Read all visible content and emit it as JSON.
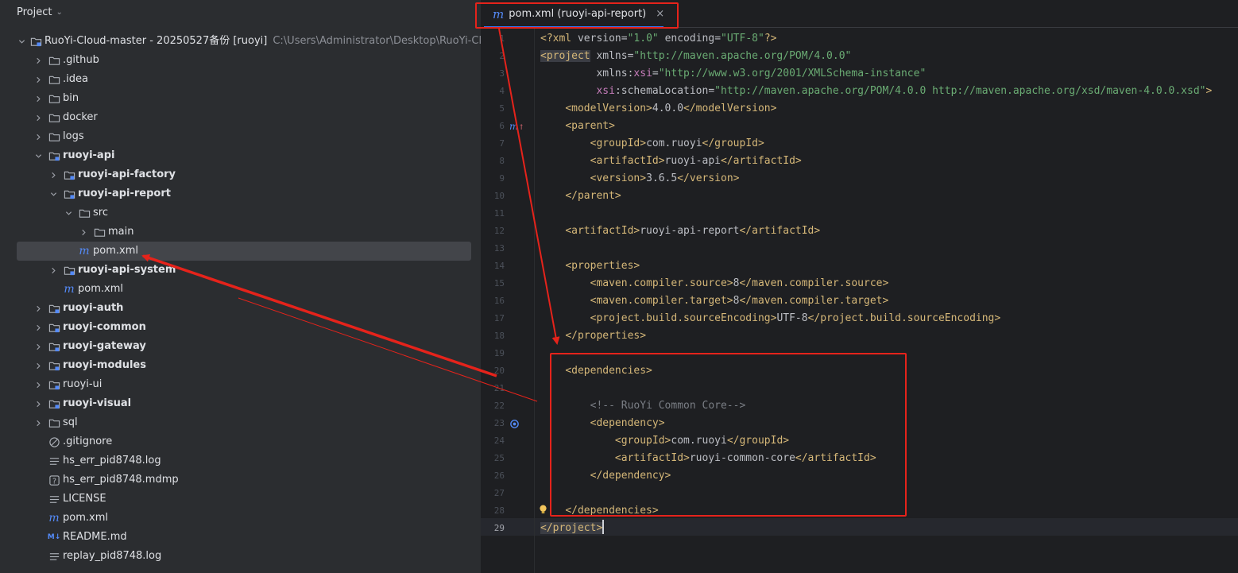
{
  "project_panel": {
    "title": "Project",
    "tree": [
      {
        "label": "RuoYi-Cloud-master - 20250527备份 [ruoyi]",
        "path": "C:\\Users\\Administrator\\Desktop\\RuoYi-Clo",
        "icon": "module-folder-icon",
        "depth": 0,
        "expanded": true,
        "bold": false
      },
      {
        "label": ".github",
        "icon": "folder-icon",
        "depth": 1,
        "expanded": false
      },
      {
        "label": ".idea",
        "icon": "folder-icon",
        "depth": 1,
        "expanded": false
      },
      {
        "label": "bin",
        "icon": "folder-icon",
        "depth": 1,
        "expanded": false
      },
      {
        "label": "docker",
        "icon": "folder-icon",
        "depth": 1,
        "expanded": false
      },
      {
        "label": "logs",
        "icon": "folder-icon",
        "depth": 1,
        "expanded": false
      },
      {
        "label": "ruoyi-api",
        "icon": "module-folder-icon",
        "depth": 1,
        "expanded": true,
        "bold": true
      },
      {
        "label": "ruoyi-api-factory",
        "icon": "module-folder-icon",
        "depth": 2,
        "expanded": false,
        "bold": true
      },
      {
        "label": "ruoyi-api-report",
        "icon": "module-folder-icon",
        "depth": 2,
        "expanded": true,
        "bold": true
      },
      {
        "label": "src",
        "icon": "folder-icon",
        "depth": 3,
        "expanded": true
      },
      {
        "label": "main",
        "icon": "folder-icon",
        "depth": 4,
        "expanded": false
      },
      {
        "label": "pom.xml",
        "icon": "maven-icon",
        "depth": 3,
        "leaf": true,
        "selected": true
      },
      {
        "label": "ruoyi-api-system",
        "icon": "module-folder-icon",
        "depth": 2,
        "expanded": false,
        "bold": true
      },
      {
        "label": "pom.xml",
        "icon": "maven-icon",
        "depth": 2,
        "leaf": true
      },
      {
        "label": "ruoyi-auth",
        "icon": "module-folder-icon",
        "depth": 1,
        "expanded": false,
        "bold": true
      },
      {
        "label": "ruoyi-common",
        "icon": "module-folder-icon",
        "depth": 1,
        "expanded": false,
        "bold": true
      },
      {
        "label": "ruoyi-gateway",
        "icon": "module-folder-icon",
        "depth": 1,
        "expanded": false,
        "bold": true
      },
      {
        "label": "ruoyi-modules",
        "icon": "module-folder-icon",
        "depth": 1,
        "expanded": false,
        "bold": true
      },
      {
        "label": "ruoyi-ui",
        "icon": "module-folder-icon",
        "depth": 1,
        "expanded": false
      },
      {
        "label": "ruoyi-visual",
        "icon": "module-folder-icon",
        "depth": 1,
        "expanded": false,
        "bold": true
      },
      {
        "label": "sql",
        "icon": "folder-icon",
        "depth": 1,
        "expanded": false
      },
      {
        "label": ".gitignore",
        "icon": "ignore-file-icon",
        "depth": 1,
        "leaf": true
      },
      {
        "label": "hs_err_pid8748.log",
        "icon": "text-file-icon",
        "depth": 1,
        "leaf": true
      },
      {
        "label": "hs_err_pid8748.mdmp",
        "icon": "unknown-file-icon",
        "depth": 1,
        "leaf": true
      },
      {
        "label": "LICENSE",
        "icon": "text-file-icon",
        "depth": 1,
        "leaf": true
      },
      {
        "label": "pom.xml",
        "icon": "maven-icon",
        "depth": 1,
        "leaf": true
      },
      {
        "label": "README.md",
        "icon": "markdown-icon",
        "depth": 1,
        "leaf": true
      },
      {
        "label": "replay_pid8748.log",
        "icon": "text-file-icon",
        "depth": 1,
        "leaf": true
      }
    ]
  },
  "editor": {
    "tab": {
      "label": "pom.xml (ruoyi-api-report)",
      "close": "×"
    },
    "current_line": 29,
    "lines": [
      {
        "n": "1",
        "tokens": [
          [
            "t",
            "<?"
          ],
          [
            "t",
            "xml "
          ],
          [
            "an",
            "version"
          ],
          [
            "tx",
            "="
          ],
          [
            "av",
            "\"1.0\""
          ],
          [
            "tx",
            " "
          ],
          [
            "an",
            "encoding"
          ],
          [
            "tx",
            "="
          ],
          [
            "av",
            "\"UTF-8\""
          ],
          [
            "t",
            "?>"
          ]
        ]
      },
      {
        "n": "2",
        "tokens": [
          [
            "t hl",
            "<project"
          ],
          [
            "tx",
            " "
          ],
          [
            "an",
            "xmlns"
          ],
          [
            "tx",
            "="
          ],
          [
            "av",
            "\"http://maven.apache.org/POM/4.0.0\""
          ]
        ]
      },
      {
        "n": "3",
        "tokens": [
          [
            "tx",
            "         "
          ],
          [
            "an",
            "xmlns"
          ],
          [
            "tx",
            ":"
          ],
          [
            "ns",
            "xsi"
          ],
          [
            "tx",
            "="
          ],
          [
            "av",
            "\"http://www.w3.org/2001/XMLSchema-instance\""
          ]
        ]
      },
      {
        "n": "4",
        "tokens": [
          [
            "tx",
            "         "
          ],
          [
            "ns",
            "xsi"
          ],
          [
            "tx",
            ":"
          ],
          [
            "an",
            "schemaLocation"
          ],
          [
            "tx",
            "="
          ],
          [
            "av",
            "\"http://maven.apache.org/POM/4.0.0 http://maven.apache.org/xsd/maven-4.0.0.xsd\""
          ],
          [
            "t",
            ">"
          ]
        ]
      },
      {
        "n": "5",
        "tokens": [
          [
            "tx",
            "    "
          ],
          [
            "t",
            "<modelVersion>"
          ],
          [
            "tx",
            "4.0.0"
          ],
          [
            "t",
            "</modelVersion>"
          ]
        ]
      },
      {
        "n": "6",
        "tokens": [
          [
            "tx",
            "    "
          ],
          [
            "t",
            "<parent>"
          ]
        ]
      },
      {
        "n": "7",
        "tokens": [
          [
            "tx",
            "        "
          ],
          [
            "t",
            "<groupId>"
          ],
          [
            "tx",
            "com.ruoyi"
          ],
          [
            "t",
            "</groupId>"
          ]
        ]
      },
      {
        "n": "8",
        "tokens": [
          [
            "tx",
            "        "
          ],
          [
            "t",
            "<artifactId>"
          ],
          [
            "tx",
            "ruoyi-api"
          ],
          [
            "t",
            "</artifactId>"
          ]
        ]
      },
      {
        "n": "9",
        "tokens": [
          [
            "tx",
            "        "
          ],
          [
            "t",
            "<version>"
          ],
          [
            "tx",
            "3.6.5"
          ],
          [
            "t",
            "</version>"
          ]
        ]
      },
      {
        "n": "10",
        "tokens": [
          [
            "tx",
            "    "
          ],
          [
            "t",
            "</parent>"
          ]
        ]
      },
      {
        "n": "11",
        "tokens": []
      },
      {
        "n": "12",
        "tokens": [
          [
            "tx",
            "    "
          ],
          [
            "t",
            "<artifactId>"
          ],
          [
            "tx",
            "ruoyi-api-report"
          ],
          [
            "t",
            "</artifactId>"
          ]
        ]
      },
      {
        "n": "13",
        "tokens": []
      },
      {
        "n": "14",
        "tokens": [
          [
            "tx",
            "    "
          ],
          [
            "t",
            "<properties>"
          ]
        ]
      },
      {
        "n": "15",
        "tokens": [
          [
            "tx",
            "        "
          ],
          [
            "t",
            "<maven.compiler.source>"
          ],
          [
            "tx",
            "8"
          ],
          [
            "t",
            "</maven.compiler.source>"
          ]
        ]
      },
      {
        "n": "16",
        "tokens": [
          [
            "tx",
            "        "
          ],
          [
            "t",
            "<maven.compiler.target>"
          ],
          [
            "tx",
            "8"
          ],
          [
            "t",
            "</maven.compiler.target>"
          ]
        ]
      },
      {
        "n": "17",
        "tokens": [
          [
            "tx",
            "        "
          ],
          [
            "t",
            "<project.build.sourceEncoding>"
          ],
          [
            "tx",
            "UTF-8"
          ],
          [
            "t",
            "</project.build.sourceEncoding>"
          ]
        ]
      },
      {
        "n": "18",
        "tokens": [
          [
            "tx",
            "    "
          ],
          [
            "t",
            "</properties>"
          ]
        ]
      },
      {
        "n": "19",
        "tokens": []
      },
      {
        "n": "20",
        "tokens": [
          [
            "tx",
            "    "
          ],
          [
            "t",
            "<dependencies>"
          ]
        ]
      },
      {
        "n": "21",
        "tokens": []
      },
      {
        "n": "22",
        "tokens": [
          [
            "tx",
            "        "
          ],
          [
            "cm",
            "<!-- RuoYi Common Core-->"
          ]
        ]
      },
      {
        "n": "23",
        "tokens": [
          [
            "tx",
            "        "
          ],
          [
            "t",
            "<dependency>"
          ]
        ]
      },
      {
        "n": "24",
        "tokens": [
          [
            "tx",
            "            "
          ],
          [
            "t",
            "<groupId>"
          ],
          [
            "tx",
            "com.ruoyi"
          ],
          [
            "t",
            "</groupId>"
          ]
        ]
      },
      {
        "n": "25",
        "tokens": [
          [
            "tx",
            "            "
          ],
          [
            "t",
            "<artifactId>"
          ],
          [
            "tx",
            "ruoyi-common-core"
          ],
          [
            "t",
            "</artifactId>"
          ]
        ]
      },
      {
        "n": "26",
        "tokens": [
          [
            "tx",
            "        "
          ],
          [
            "t",
            "</dependency>"
          ]
        ]
      },
      {
        "n": "27",
        "tokens": []
      },
      {
        "n": "28",
        "tokens": [
          [
            "tx",
            "    "
          ],
          [
            "t",
            "</dependencies>"
          ]
        ]
      },
      {
        "n": "29",
        "tokens": [
          [
            "t hl",
            "</project>"
          ]
        ]
      }
    ]
  },
  "colors": {
    "annotation_red": "#e5231b",
    "accent_blue": "#3574f0",
    "maven_blue": "#548af7"
  }
}
